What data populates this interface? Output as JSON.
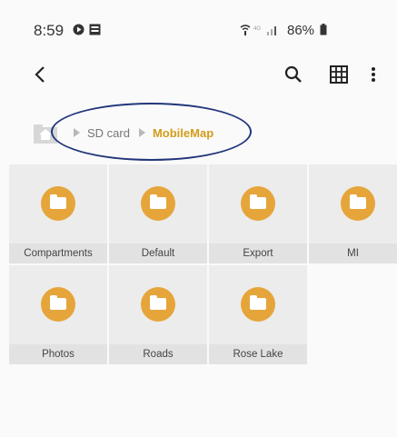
{
  "status_bar": {
    "time": "8:59",
    "battery": "86%"
  },
  "app_bar": {
    "back_icon": "chevron-left-icon",
    "search_icon": "search-icon",
    "grid_icon": "grid-view-icon",
    "more_icon": "more-vertical-icon"
  },
  "breadcrumb": {
    "home_icon": "home-icon",
    "items": [
      "SD card",
      "MobileMap"
    ]
  },
  "folders": [
    {
      "name": "Compartments"
    },
    {
      "name": "Default"
    },
    {
      "name": "Export"
    },
    {
      "name": "MI"
    },
    {
      "name": "Photos"
    },
    {
      "name": "Roads"
    },
    {
      "name": "Rose Lake"
    }
  ],
  "colors": {
    "folder": "#e6a53a",
    "active_crumb": "#d39d1b",
    "annotation": "#22367a"
  }
}
